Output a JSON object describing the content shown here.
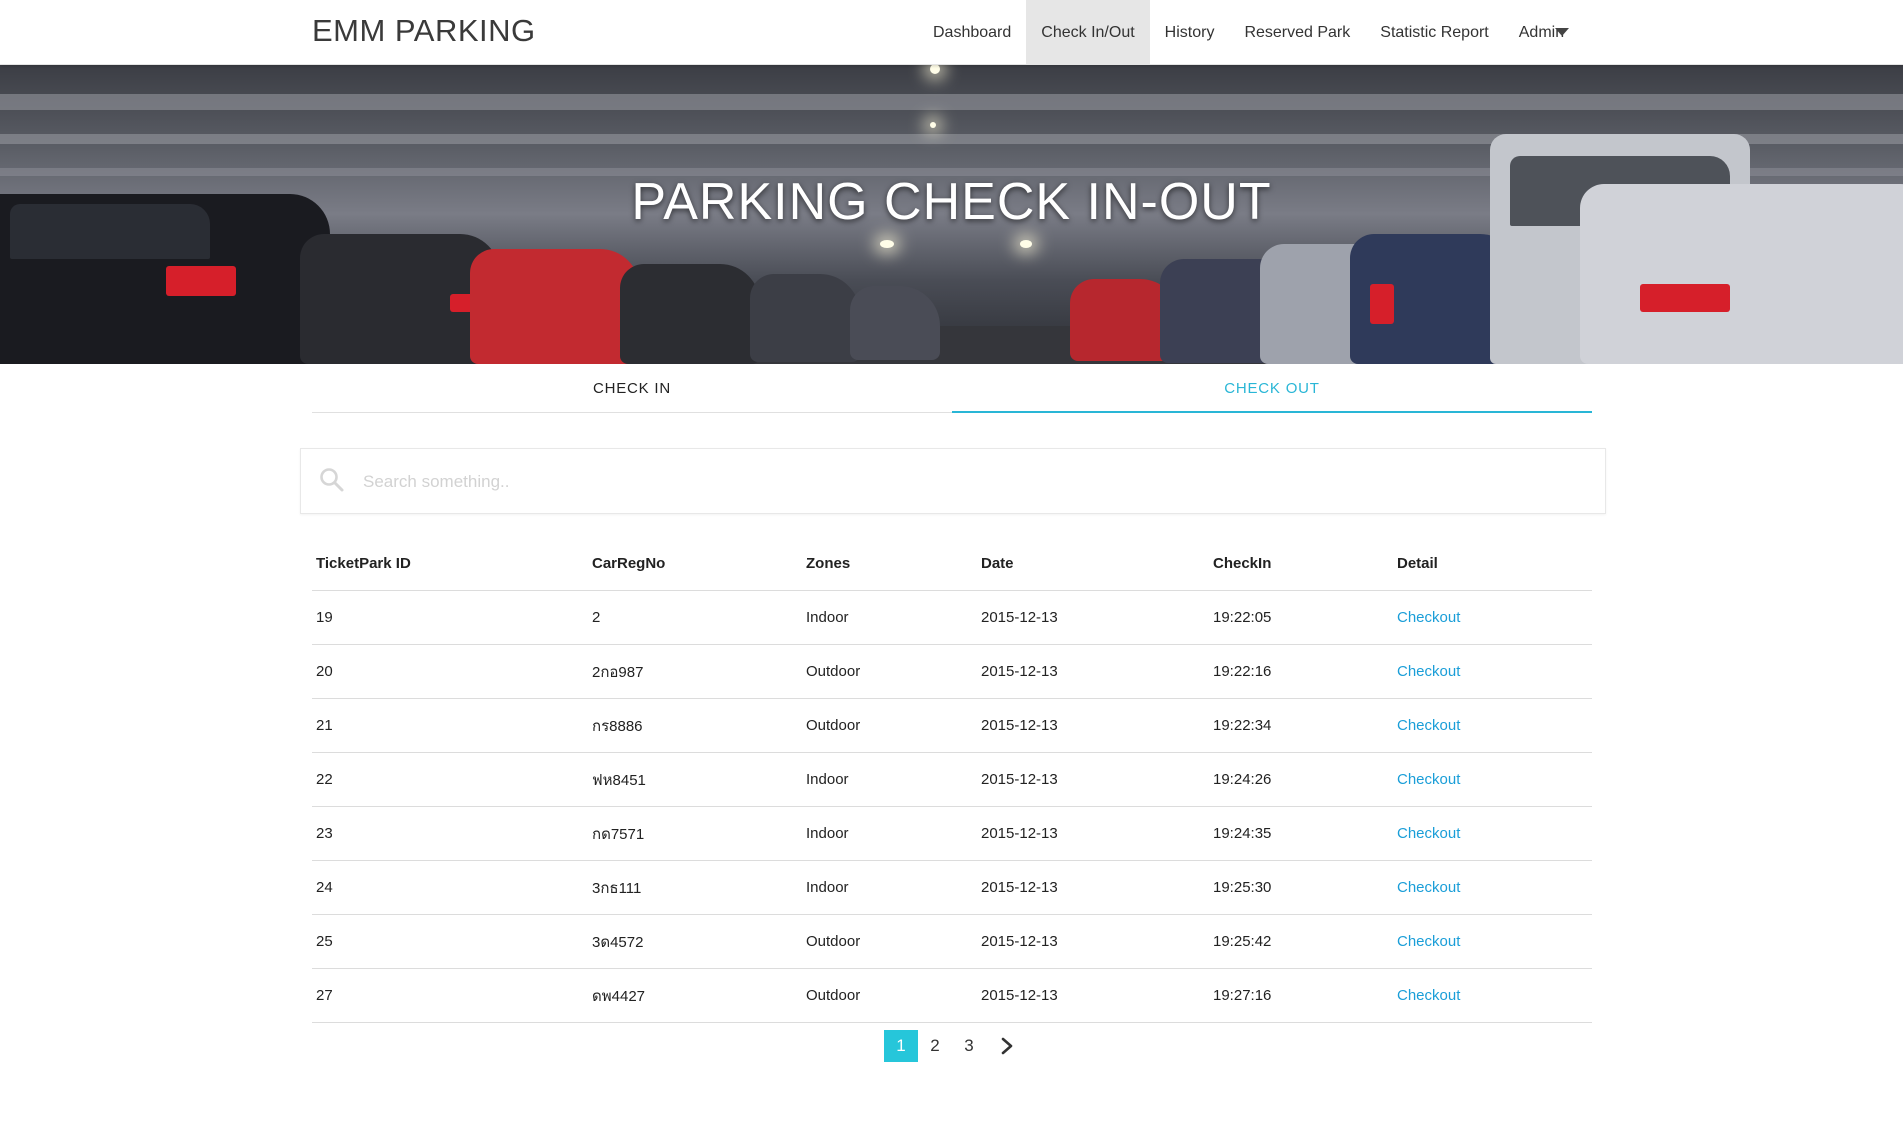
{
  "app": {
    "brand": "EMM PARKING"
  },
  "nav": {
    "items": [
      {
        "label": "Dashboard",
        "active": false
      },
      {
        "label": "Check In/Out",
        "active": true
      },
      {
        "label": "History",
        "active": false
      },
      {
        "label": "Reserved Park",
        "active": false
      },
      {
        "label": "Statistic Report",
        "active": false
      },
      {
        "label": "Admin",
        "active": false
      }
    ],
    "dropdown_icon": "caret-down-icon"
  },
  "hero": {
    "title": "PARKING CHECK IN-OUT"
  },
  "tabs": [
    {
      "label": "CHECK IN",
      "active": false
    },
    {
      "label": "CHECK OUT",
      "active": true
    }
  ],
  "search": {
    "placeholder": "Search something..",
    "value": "",
    "icon": "search-icon"
  },
  "table": {
    "headers": [
      "TicketPark ID",
      "CarRegNo",
      "Zones",
      "Date",
      "CheckIn",
      "Detail"
    ],
    "rows": [
      {
        "id": "19",
        "reg": "2",
        "zone": "Indoor",
        "date": "2015-12-13",
        "checkin": "19:22:05",
        "action": "Checkout"
      },
      {
        "id": "20",
        "reg": "2กอ987",
        "zone": "Outdoor",
        "date": "2015-12-13",
        "checkin": "19:22:16",
        "action": "Checkout"
      },
      {
        "id": "21",
        "reg": "กร8886",
        "zone": "Outdoor",
        "date": "2015-12-13",
        "checkin": "19:22:34",
        "action": "Checkout"
      },
      {
        "id": "22",
        "reg": "ฟห8451",
        "zone": "Indoor",
        "date": "2015-12-13",
        "checkin": "19:24:26",
        "action": "Checkout"
      },
      {
        "id": "23",
        "reg": "กด7571",
        "zone": "Indoor",
        "date": "2015-12-13",
        "checkin": "19:24:35",
        "action": "Checkout"
      },
      {
        "id": "24",
        "reg": "3กธ111",
        "zone": "Indoor",
        "date": "2015-12-13",
        "checkin": "19:25:30",
        "action": "Checkout"
      },
      {
        "id": "25",
        "reg": "3ด4572",
        "zone": "Outdoor",
        "date": "2015-12-13",
        "checkin": "19:25:42",
        "action": "Checkout"
      },
      {
        "id": "27",
        "reg": "ดพ4427",
        "zone": "Outdoor",
        "date": "2015-12-13",
        "checkin": "19:27:16",
        "action": "Checkout"
      }
    ]
  },
  "pagination": {
    "pages": [
      "1",
      "2",
      "3"
    ],
    "current": "1",
    "next_icon": "chevron-right-icon"
  },
  "colors": {
    "accent": "#29b6d6",
    "link": "#1a9ed8",
    "active_page": "#26c6da",
    "nav_active_bg": "#e6e6e6"
  }
}
